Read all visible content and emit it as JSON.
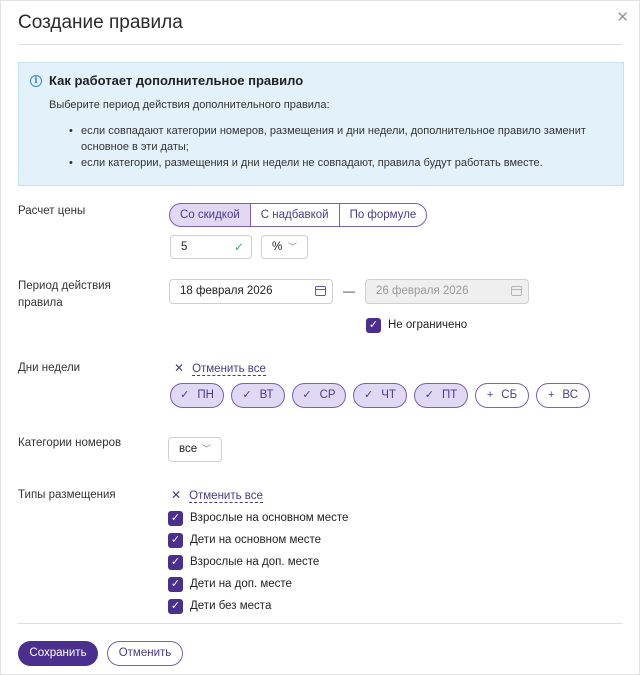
{
  "dialog": {
    "title": "Создание правила",
    "close_icon": "close-icon"
  },
  "info": {
    "icon": "info-icon",
    "icon_glyph": "i",
    "title": "Как работает дополнительное правило",
    "subtitle": "Выберите период действия дополнительного правила:",
    "bullets": [
      "если совпадают категории номеров, размещения и дни недели, дополнительное правило заменит основное в эти даты;",
      "если категории, размещения и дни недели не совпадают, правила будут работать вместе."
    ]
  },
  "price": {
    "label": "Расчет цены",
    "options": [
      "Со скидкой",
      "С надбавкой",
      "По формуле"
    ],
    "selected": "Со скидкой",
    "amount": "5",
    "unit": "%"
  },
  "period": {
    "label": "Период действия правила",
    "from": "18 февраля 2026",
    "to": "26 февраля 2026",
    "dash": "—",
    "unlimited_label": "Не ограничено",
    "unlimited_checked": true
  },
  "weekdays": {
    "label": "Дни недели",
    "reset_label": "Отменить все",
    "days": [
      {
        "label": "ПН",
        "selected": true
      },
      {
        "label": "ВТ",
        "selected": true
      },
      {
        "label": "СР",
        "selected": true
      },
      {
        "label": "ЧТ",
        "selected": true
      },
      {
        "label": "ПТ",
        "selected": true
      },
      {
        "label": "СБ",
        "selected": false
      },
      {
        "label": "ВС",
        "selected": false
      }
    ]
  },
  "room_categories": {
    "label": "Категории номеров",
    "value": "все"
  },
  "placement": {
    "label": "Типы размещения",
    "reset_label": "Отменить все",
    "items": [
      {
        "label": "Взрослые на основном месте",
        "checked": true
      },
      {
        "label": "Дети на основном месте",
        "checked": true
      },
      {
        "label": "Взрослые на доп. месте",
        "checked": true
      },
      {
        "label": "Дети на доп. месте",
        "checked": true
      },
      {
        "label": "Дети без места",
        "checked": true
      }
    ]
  },
  "footer": {
    "save_label": "Сохранить",
    "cancel_label": "Отменить"
  },
  "colors": {
    "accent": "#4a2f8f",
    "accent_light": "#e1d8f3",
    "info_bg": "#e3f1fb",
    "success": "#3bb56b"
  }
}
